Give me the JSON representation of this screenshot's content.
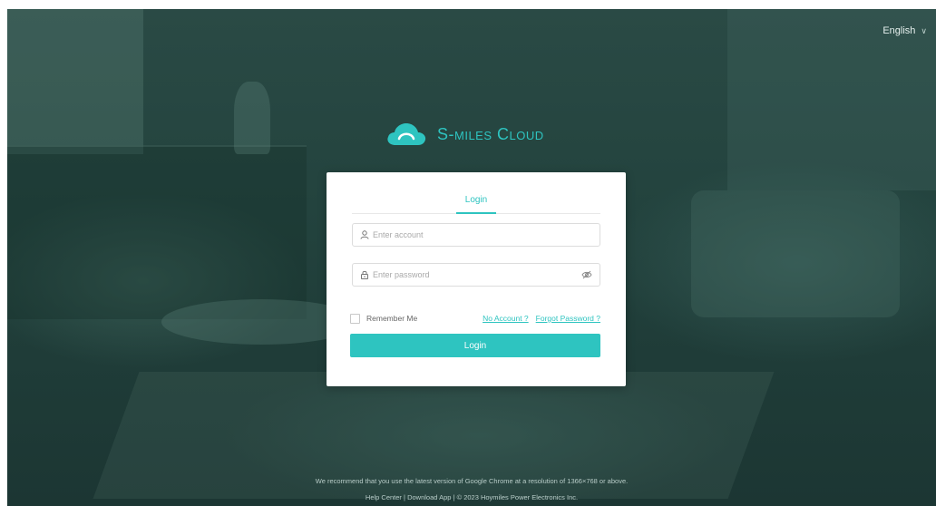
{
  "header": {
    "language": "English"
  },
  "brand": {
    "name": "S-miles Cloud",
    "logo_color": "#2ec4c0"
  },
  "login_card": {
    "tab_label": "Login",
    "account_placeholder": "Enter account",
    "password_placeholder": "Enter password",
    "remember_label": "Remember Me",
    "no_account_link": "No Account ?",
    "forgot_password_link": "Forgot Password ?",
    "login_button": "Login"
  },
  "footer": {
    "recommendation": "We recommend that you use the latest version of Google Chrome at a resolution of 1366×768 or above.",
    "help_center": "Help Center",
    "separator": "|",
    "download_app": "Download App",
    "copyright": "© 2023 Hoymiles Power Electronics Inc."
  },
  "colors": {
    "accent": "#2ec4c0",
    "background": "#23433e"
  }
}
